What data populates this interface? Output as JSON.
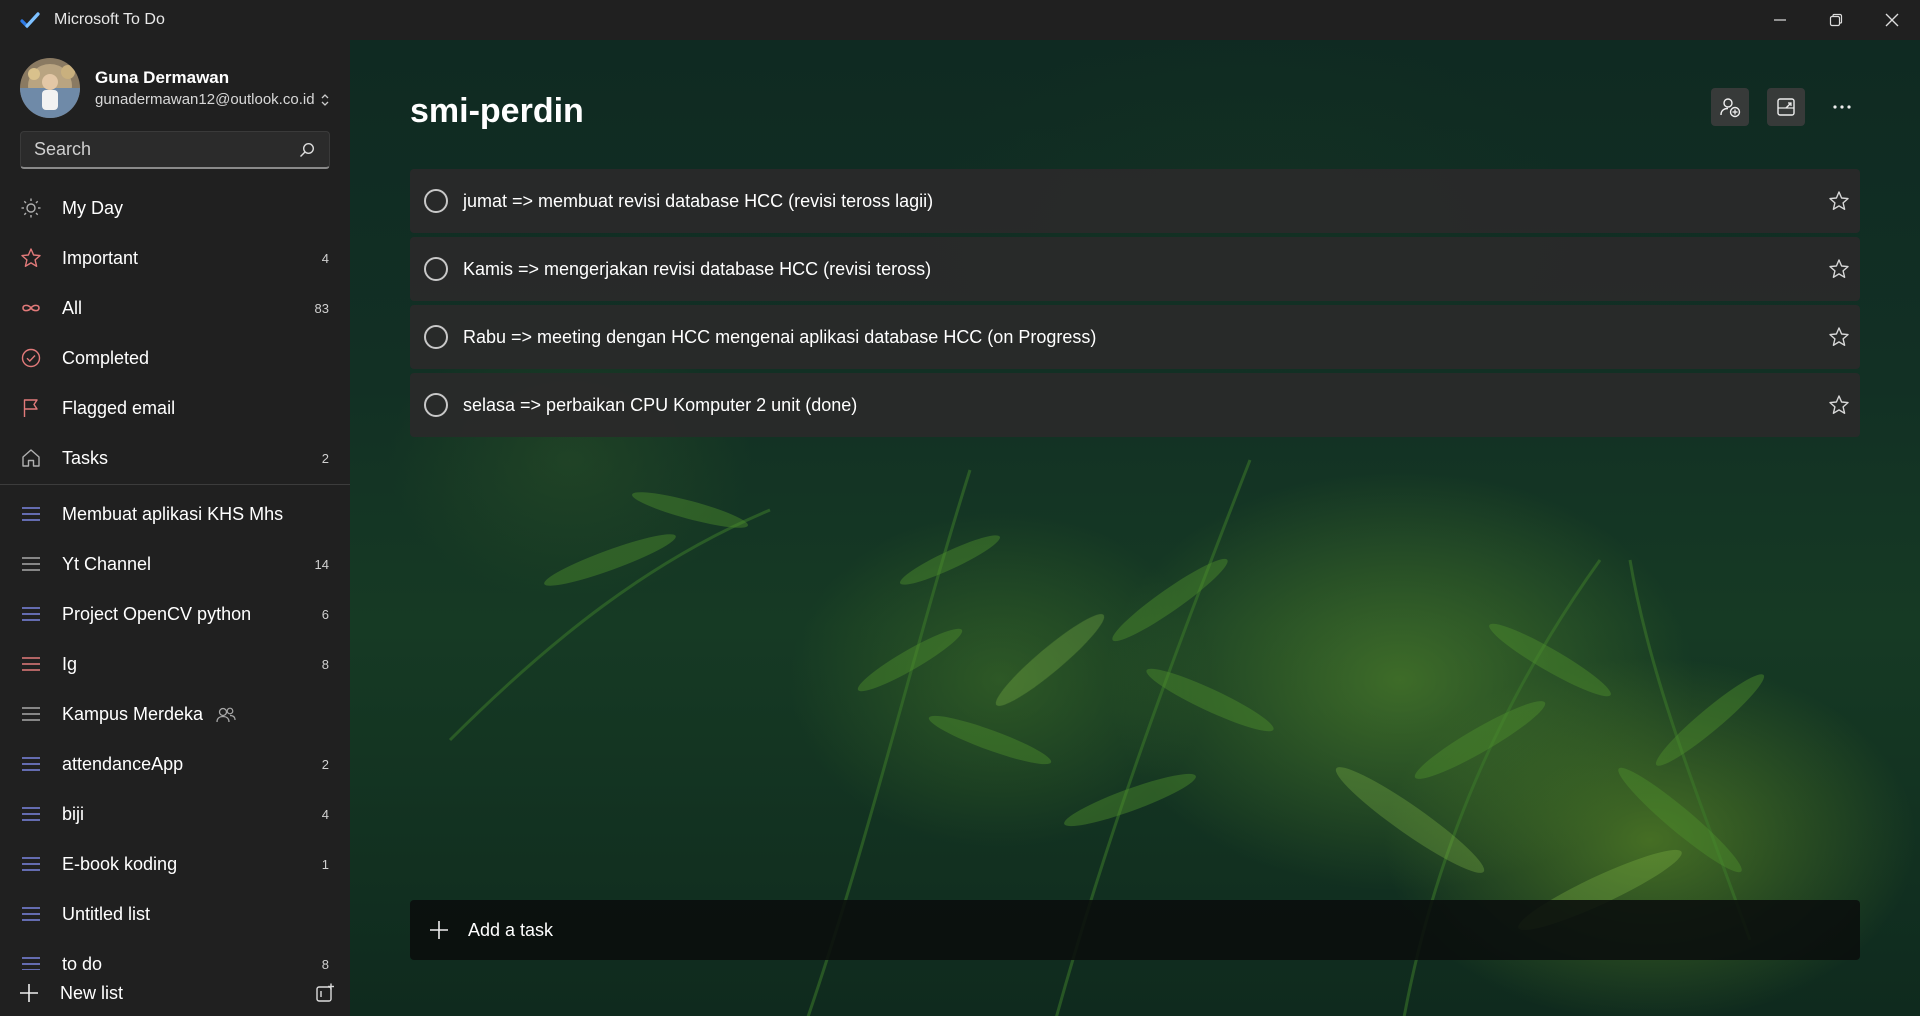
{
  "window": {
    "title": "Microsoft To Do",
    "logo_icon": "todo-check-logo",
    "controls": [
      "minimize-icon",
      "restore-icon",
      "close-icon"
    ]
  },
  "profile": {
    "name": "Guna Dermawan",
    "email": "gunadermawan12@outlook.co.id"
  },
  "search": {
    "placeholder": "Search"
  },
  "smart_lists": [
    {
      "label": "My Day",
      "count": "",
      "icon": "sun-icon",
      "color": "#b0b0b0"
    },
    {
      "label": "Important",
      "count": "4",
      "icon": "star-icon",
      "color": "#e27a7a"
    },
    {
      "label": "All",
      "count": "83",
      "icon": "infinity-icon",
      "color": "#e27a7a"
    },
    {
      "label": "Completed",
      "count": "",
      "icon": "check-circle-icon",
      "color": "#e27a7a"
    },
    {
      "label": "Flagged email",
      "count": "",
      "icon": "flag-icon",
      "color": "#e27a7a"
    },
    {
      "label": "Tasks",
      "count": "2",
      "icon": "home-icon",
      "color": "#b0b0b0"
    }
  ],
  "custom_lists": [
    {
      "label": "Membuat aplikasi KHS Mhs",
      "count": "",
      "color": "#7b86e0",
      "shared": false
    },
    {
      "label": "Yt Channel",
      "count": "14",
      "color": "#a8a8a8",
      "shared": false
    },
    {
      "label": "Project OpenCV python",
      "count": "6",
      "color": "#7b86e0",
      "shared": false
    },
    {
      "label": "Ig",
      "count": "8",
      "color": "#e27a7a",
      "shared": false
    },
    {
      "label": "Kampus Merdeka",
      "count": "",
      "color": "#a8a8a8",
      "shared": true
    },
    {
      "label": "attendanceApp",
      "count": "2",
      "color": "#7b86e0",
      "shared": false
    },
    {
      "label": "biji",
      "count": "4",
      "color": "#7b86e0",
      "shared": false
    },
    {
      "label": "E-book koding",
      "count": "1",
      "color": "#7b86e0",
      "shared": false
    },
    {
      "label": "Untitled list",
      "count": "",
      "color": "#7b86e0",
      "shared": false
    },
    {
      "label": "to do",
      "count": "8",
      "color": "#7b86e0",
      "shared": false
    }
  ],
  "new_list": {
    "label": "New list"
  },
  "main": {
    "title": "smi-perdin",
    "header_actions": [
      "share-person-icon",
      "background-image-icon",
      "more-options-icon"
    ],
    "tasks": [
      {
        "title": "jumat => membuat revisi database HCC (revisi teross lagii)"
      },
      {
        "title": "Kamis => mengerjakan revisi database HCC (revisi teross)"
      },
      {
        "title": "Rabu => meeting dengan HCC mengenai aplikasi database HCC (on Progress)"
      },
      {
        "title": "selasa => perbaikan CPU Komputer 2 unit (done)"
      }
    ],
    "add_task_label": "Add a task"
  }
}
